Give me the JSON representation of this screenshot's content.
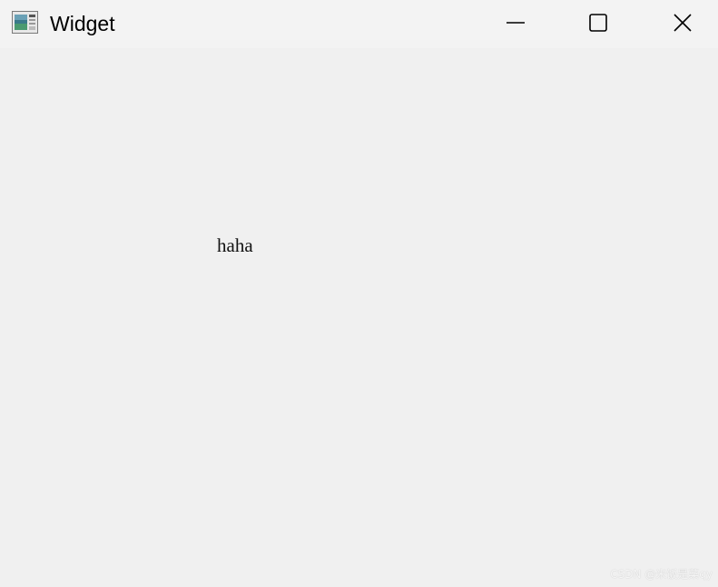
{
  "window": {
    "title": "Widget",
    "icon": "qt-widget-app-icon",
    "controls": {
      "minimize": "minimize-icon",
      "maximize": "maximize-icon",
      "close": "close-icon"
    }
  },
  "content": {
    "label_text": "haha"
  },
  "watermark": {
    "text": "CSDN @米饭是菜qy"
  },
  "colors": {
    "titlebar_bg": "#f3f3f3",
    "client_bg": "#f0f0f0",
    "text": "#111111"
  }
}
